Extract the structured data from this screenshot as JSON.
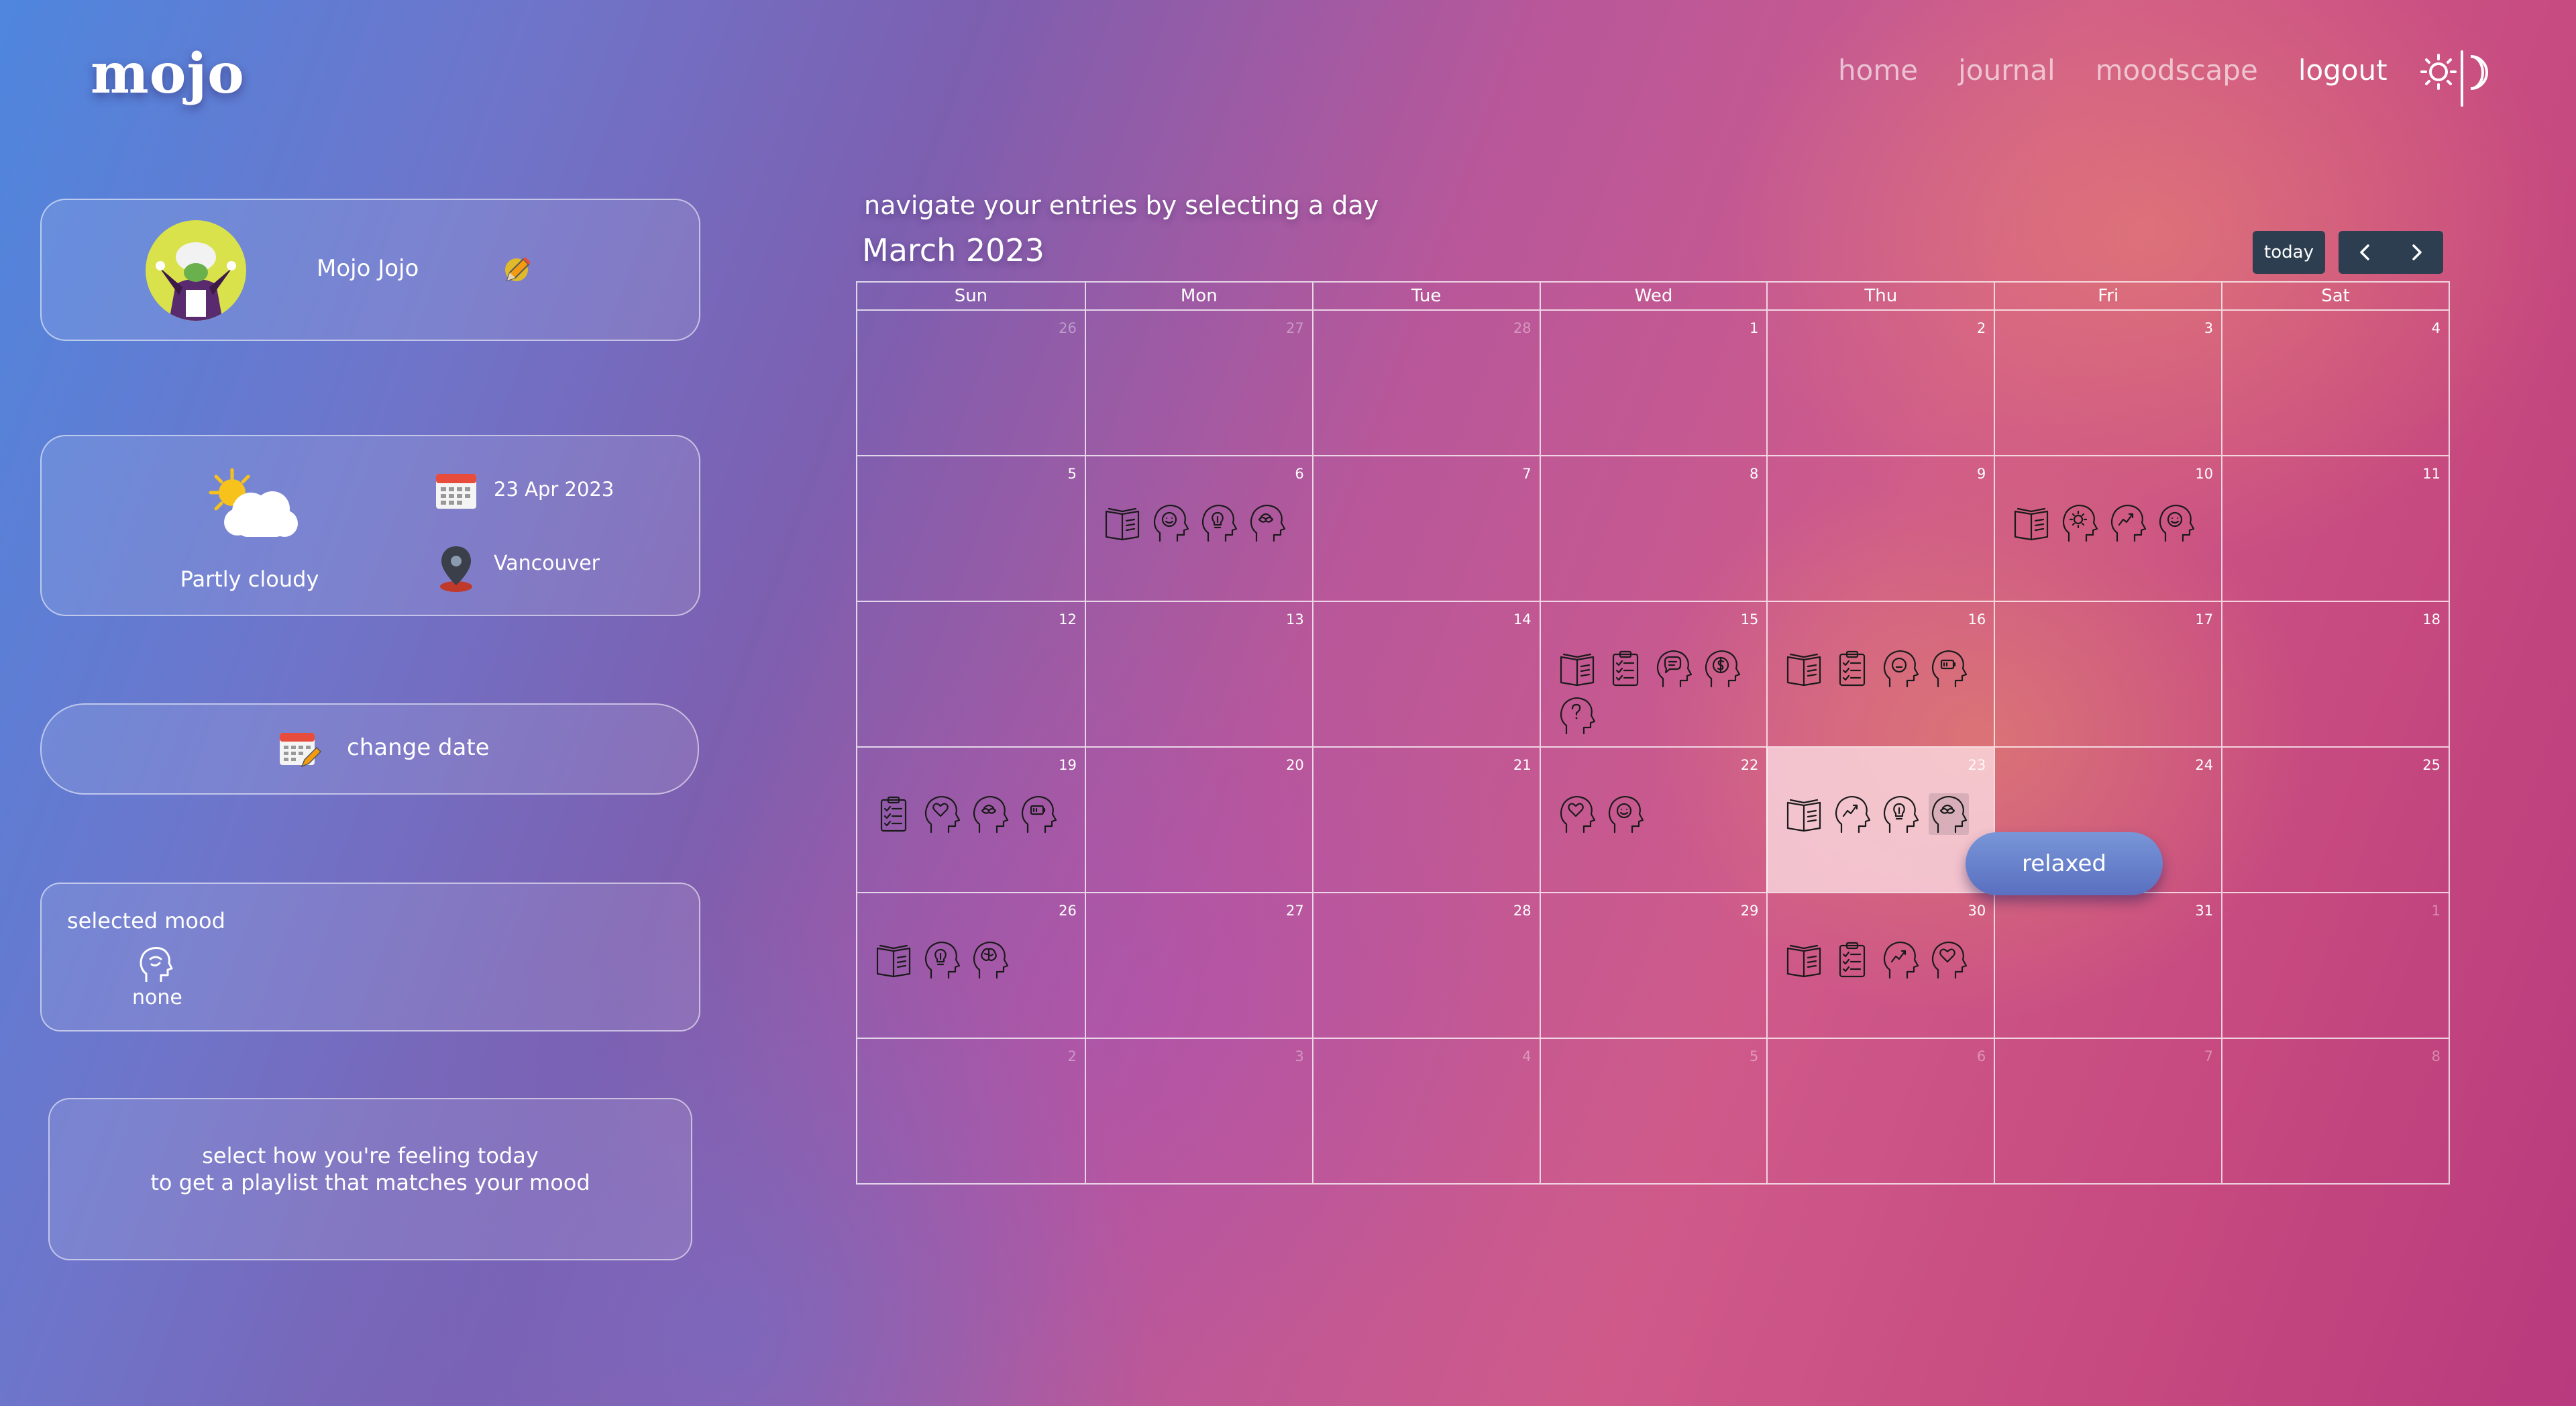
{
  "header": {
    "logo": "mojo",
    "nav": [
      {
        "label": "home"
      },
      {
        "label": "journal"
      },
      {
        "label": "moodscape"
      },
      {
        "label": "logout"
      }
    ],
    "theme_toggle_icon": "sun-moon-icon"
  },
  "profile": {
    "name": "Mojo Jojo",
    "avatar_icon": "avatar-icon",
    "edit_icon": "pencil-icon"
  },
  "weather": {
    "condition": "Partly cloudy",
    "date": "23 Apr 2023",
    "location": "Vancouver"
  },
  "change_date": {
    "label": "change date"
  },
  "selected_mood": {
    "title": "selected mood",
    "value": "none"
  },
  "playlist": {
    "line1": "select how you're feeling today",
    "line2": "to get a playlist that matches your mood"
  },
  "calendar": {
    "hint": "navigate your entries by selecting a day",
    "title": "March 2023",
    "today_label": "today",
    "weekdays": [
      "Sun",
      "Mon",
      "Tue",
      "Wed",
      "Thu",
      "Fri",
      "Sat"
    ],
    "weeks": [
      [
        {
          "d": "26",
          "o": true
        },
        {
          "d": "27",
          "o": true
        },
        {
          "d": "28",
          "o": true
        },
        {
          "d": "1"
        },
        {
          "d": "2"
        },
        {
          "d": "3"
        },
        {
          "d": "4"
        }
      ],
      [
        {
          "d": "5"
        },
        {
          "d": "6",
          "icons": [
            "book",
            "smile",
            "bulb",
            "relaxed"
          ]
        },
        {
          "d": "7"
        },
        {
          "d": "8"
        },
        {
          "d": "9"
        },
        {
          "d": "10",
          "icons": [
            "book",
            "sun",
            "trend",
            "smile"
          ]
        },
        {
          "d": "11"
        }
      ],
      [
        {
          "d": "12"
        },
        {
          "d": "13"
        },
        {
          "d": "14"
        },
        {
          "d": "15",
          "icons": [
            "book",
            "checklist",
            "chat",
            "dollar",
            "question"
          ]
        },
        {
          "d": "16",
          "icons": [
            "book",
            "checklist",
            "neutral",
            "battery"
          ]
        },
        {
          "d": "17"
        },
        {
          "d": "18"
        }
      ],
      [
        {
          "d": "19",
          "icons": [
            "checklist",
            "heart",
            "relaxed",
            "battery"
          ]
        },
        {
          "d": "20"
        },
        {
          "d": "21"
        },
        {
          "d": "22",
          "icons": [
            "heart",
            "smile"
          ]
        },
        {
          "d": "23",
          "selected": true,
          "icons": [
            "book",
            "trend",
            "bulb",
            "relaxed"
          ]
        },
        {
          "d": "24"
        },
        {
          "d": "25"
        }
      ],
      [
        {
          "d": "26",
          "icons": [
            "book",
            "bulb",
            "brain"
          ]
        },
        {
          "d": "27"
        },
        {
          "d": "28"
        },
        {
          "d": "29"
        },
        {
          "d": "30",
          "icons": [
            "book",
            "checklist",
            "trend",
            "heart"
          ]
        },
        {
          "d": "31"
        },
        {
          "d": "1",
          "o": true
        }
      ],
      [
        {
          "d": "2",
          "o": true
        },
        {
          "d": "3",
          "o": true
        },
        {
          "d": "4",
          "o": true
        },
        {
          "d": "5",
          "o": true
        },
        {
          "d": "6",
          "o": true
        },
        {
          "d": "7",
          "o": true
        },
        {
          "d": "8",
          "o": true
        }
      ]
    ],
    "tooltip": "relaxed"
  }
}
